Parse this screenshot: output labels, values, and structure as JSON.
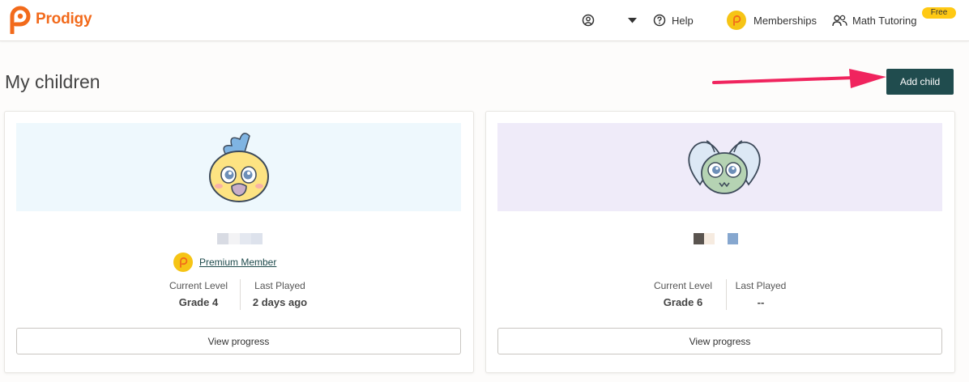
{
  "header": {
    "brand": "Prodigy",
    "account_icon": "user-circle-icon",
    "dropdown_icon": "caret-down-icon",
    "help_label": "Help",
    "memberships_label": "Memberships",
    "tutoring_label": "Math Tutoring",
    "tutoring_badge": "Free"
  },
  "page": {
    "title": "My children",
    "add_child_label": "Add child"
  },
  "children": [
    {
      "banner_color": "#eef8fd",
      "avatar": "yellow-bird-avatar",
      "membership_label": "Premium Member",
      "stats": [
        {
          "label": "Current Level",
          "value": "Grade 4"
        },
        {
          "label": "Last Played",
          "value": "2 days ago"
        }
      ],
      "view_label": "View progress"
    },
    {
      "banner_color": "#efebf9",
      "avatar": "green-owl-avatar",
      "stats": [
        {
          "label": "Current Level",
          "value": "Grade 6"
        },
        {
          "label": "Last Played",
          "value": "--"
        }
      ],
      "view_label": "View progress"
    }
  ],
  "colors": {
    "brand_orange": "#f26a1b",
    "primary_button": "#204c4e",
    "coin_yellow": "#f6c415",
    "annotation_arrow": "#f0245e"
  }
}
